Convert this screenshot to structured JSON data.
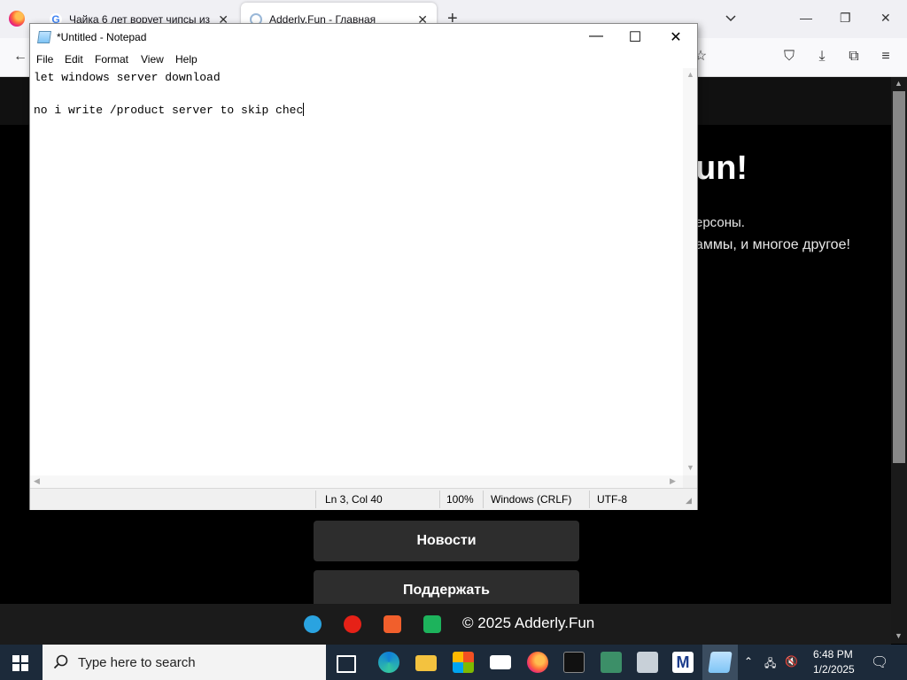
{
  "browser": {
    "tabs": [
      {
        "title": "Чайка 6 лет ворует чипсы из",
        "favicon": "google-icon",
        "active": false
      },
      {
        "title": "Adderly.Fun - Главная",
        "favicon": "wordpress-icon",
        "active": true
      }
    ],
    "new_tab": "+"
  },
  "website": {
    "hero_title": "un!",
    "hero_line1": "ерсоны.",
    "hero_line2": "аммы, и многое другое!",
    "buttons": [
      "Новости",
      "Поддержать"
    ],
    "footer_text": "© 2025 Adderly.Fun",
    "social_icons": [
      "telegram-icon",
      "youtube-icon",
      "boosty-icon",
      "vk-play-icon"
    ]
  },
  "notepad": {
    "title": "*Untitled - Notepad",
    "menu": [
      "File",
      "Edit",
      "Format",
      "View",
      "Help"
    ],
    "lines": [
      "let windows server download",
      "",
      "no i write /product server to skip chec"
    ],
    "status": {
      "position": "Ln 3, Col 40",
      "zoom": "100%",
      "line_endings": "Windows (CRLF)",
      "encoding": "UTF-8"
    }
  },
  "taskbar": {
    "search_placeholder": "Type here to search",
    "time": "6:48 PM",
    "date": "1/2/2025",
    "pinned": [
      "task-view-icon",
      "edge-icon",
      "file-explorer-icon",
      "store-icon",
      "mail-icon",
      "firefox-icon",
      "terminal-icon",
      "app-icon",
      "network-app-icon",
      "malwarebytes-icon",
      "notepad-icon"
    ]
  },
  "colors": {
    "taskbar": "#1c2a3a",
    "website_bg": "#000000",
    "site_button": "#2d2d2d"
  }
}
